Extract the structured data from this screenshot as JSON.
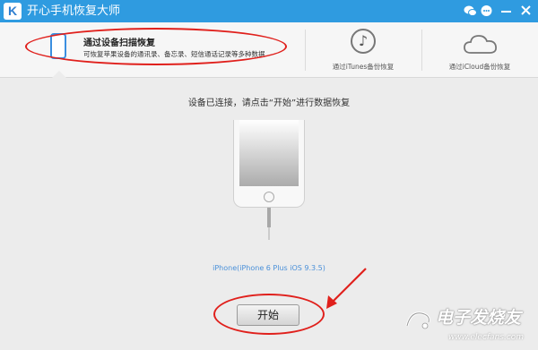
{
  "window": {
    "logo_letter": "K",
    "title": "开心手机恢复大师",
    "controls": [
      "wechat-icon",
      "feedback-icon",
      "minimize-icon",
      "close-icon"
    ]
  },
  "tabs": [
    {
      "title": "通过设备扫描恢复",
      "description": "可恢复苹果设备的通讯录、备忘录、短信通话记录等多种数据",
      "icon": "phone-icon",
      "active": true
    },
    {
      "label": "通过iTunes备份恢复",
      "icon": "music-note-icon",
      "active": false
    },
    {
      "label": "通过iCloud备份恢复",
      "icon": "cloud-icon",
      "active": false
    }
  ],
  "main": {
    "instruction": "设备已连接，请点击“开始”进行数据恢复",
    "device_info": "iPhone(iPhone 6 Plus iOS 9.3.5)",
    "start_button": "开始"
  },
  "watermark": {
    "text": "电子发烧友",
    "url": "www.elecfans.com"
  },
  "colors": {
    "titlebar": "#2f9be0",
    "annotation": "#e0201c",
    "link": "#4a90d9"
  }
}
